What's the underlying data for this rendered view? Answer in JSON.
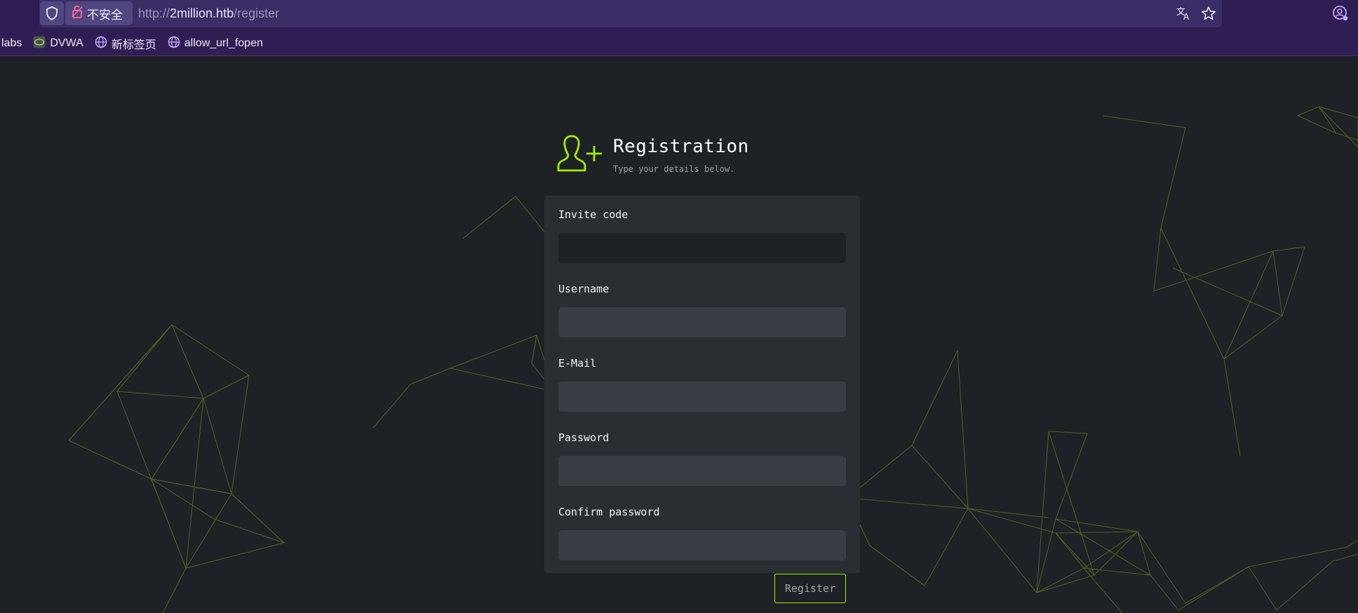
{
  "browser": {
    "insecure_label": "不安全",
    "url_scheme": "http://",
    "url_host": "2million.htb",
    "url_path": "/register",
    "icons": [
      "shield-icon",
      "broken-lock-icon",
      "translate-icon",
      "star-icon",
      "profile-icon"
    ]
  },
  "bookmarks": [
    {
      "label": "labs",
      "icon": "none"
    },
    {
      "label": "DVWA",
      "icon": "dvwa-icon"
    },
    {
      "label": "新标签页",
      "icon": "globe-icon"
    },
    {
      "label": "allow_url_fopen",
      "icon": "globe-icon"
    }
  ],
  "page": {
    "title": "Registration",
    "subtitle": "Type your details below.",
    "fields": [
      {
        "label": "Invite code",
        "value": ""
      },
      {
        "label": "Username",
        "value": ""
      },
      {
        "label": "E-Mail",
        "value": ""
      },
      {
        "label": "Password",
        "value": ""
      },
      {
        "label": "Confirm password",
        "value": ""
      }
    ],
    "register_label": "Register"
  },
  "colors": {
    "accent": "#9fef00",
    "page_bg": "#1e2125",
    "card_bg": "#2a2e33",
    "browser_bg": "#2f1e54"
  }
}
